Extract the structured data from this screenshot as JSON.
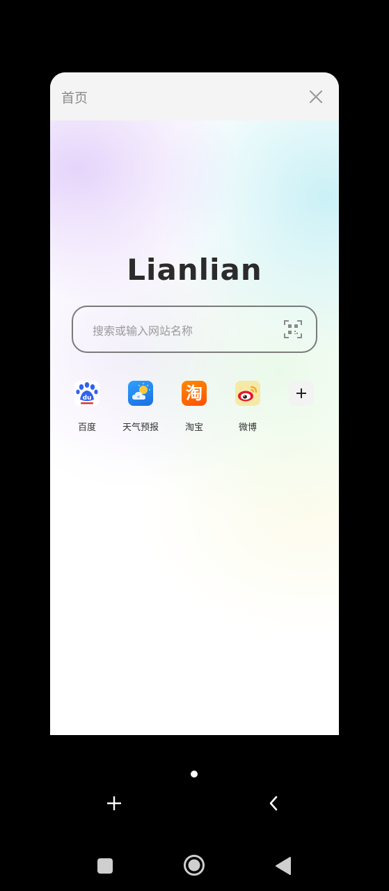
{
  "tab": {
    "title": "首页"
  },
  "page": {
    "logo_text": "Lianlian",
    "search_placeholder": "搜索或输入网站名称"
  },
  "shortcuts": [
    {
      "label": "百度",
      "icon": "baidu-icon"
    },
    {
      "label": "天气预报",
      "icon": "weather-icon"
    },
    {
      "label": "淘宝",
      "icon": "taobao-icon",
      "glyph": "淘"
    },
    {
      "label": "微博",
      "icon": "weibo-icon"
    }
  ],
  "colors": {
    "background": "#000000",
    "baidu_blue": "#2f62f0",
    "baidu_red": "#e0322b",
    "weather_blue": "#1e8cf0",
    "taobao_orange": "#ff6a00",
    "weibo_yellow": "#f6e9a7",
    "weibo_red": "#e6162d"
  },
  "pager": {
    "pages": 1,
    "current": 1
  }
}
